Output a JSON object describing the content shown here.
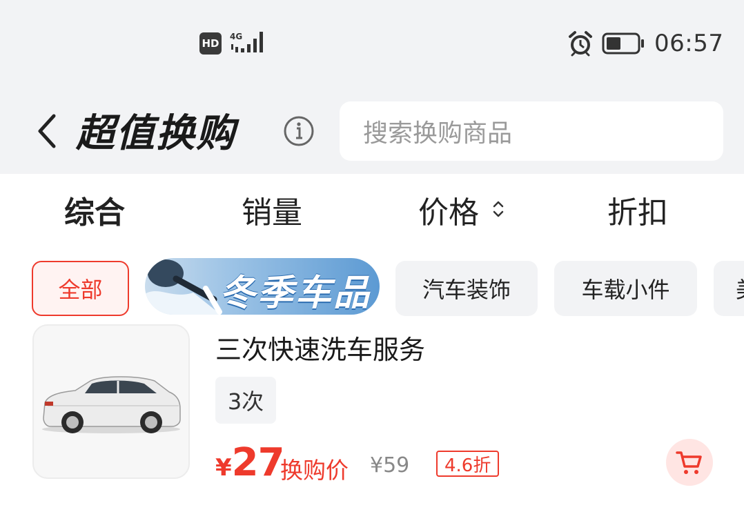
{
  "status_bar": {
    "hd_label": "HD",
    "network_label": "4G",
    "time": "06:57",
    "icons": [
      "hd-icon",
      "signal-icon",
      "alarm-icon",
      "battery-icon"
    ]
  },
  "header": {
    "title": "超值换购",
    "search_placeholder": "搜索换购商品"
  },
  "sort_tabs": [
    {
      "label": "综合",
      "active": true
    },
    {
      "label": "销量"
    },
    {
      "label": "价格"
    },
    {
      "label": "折扣"
    }
  ],
  "categories": [
    {
      "label": "全部",
      "active": true
    },
    {
      "label": "冬季车品",
      "banner": true
    },
    {
      "label": "汽车装饰"
    },
    {
      "label": "车载小件"
    },
    {
      "label": "美"
    }
  ],
  "product": {
    "name": "三次快速洗车服务",
    "spec": "3次",
    "price_currency": "¥",
    "price": "27",
    "price_label": "换购价",
    "original_price": "¥59",
    "discount": "4.6折"
  },
  "colors": {
    "accent": "#ee3a2c",
    "top_background": "#f2f3f5"
  }
}
